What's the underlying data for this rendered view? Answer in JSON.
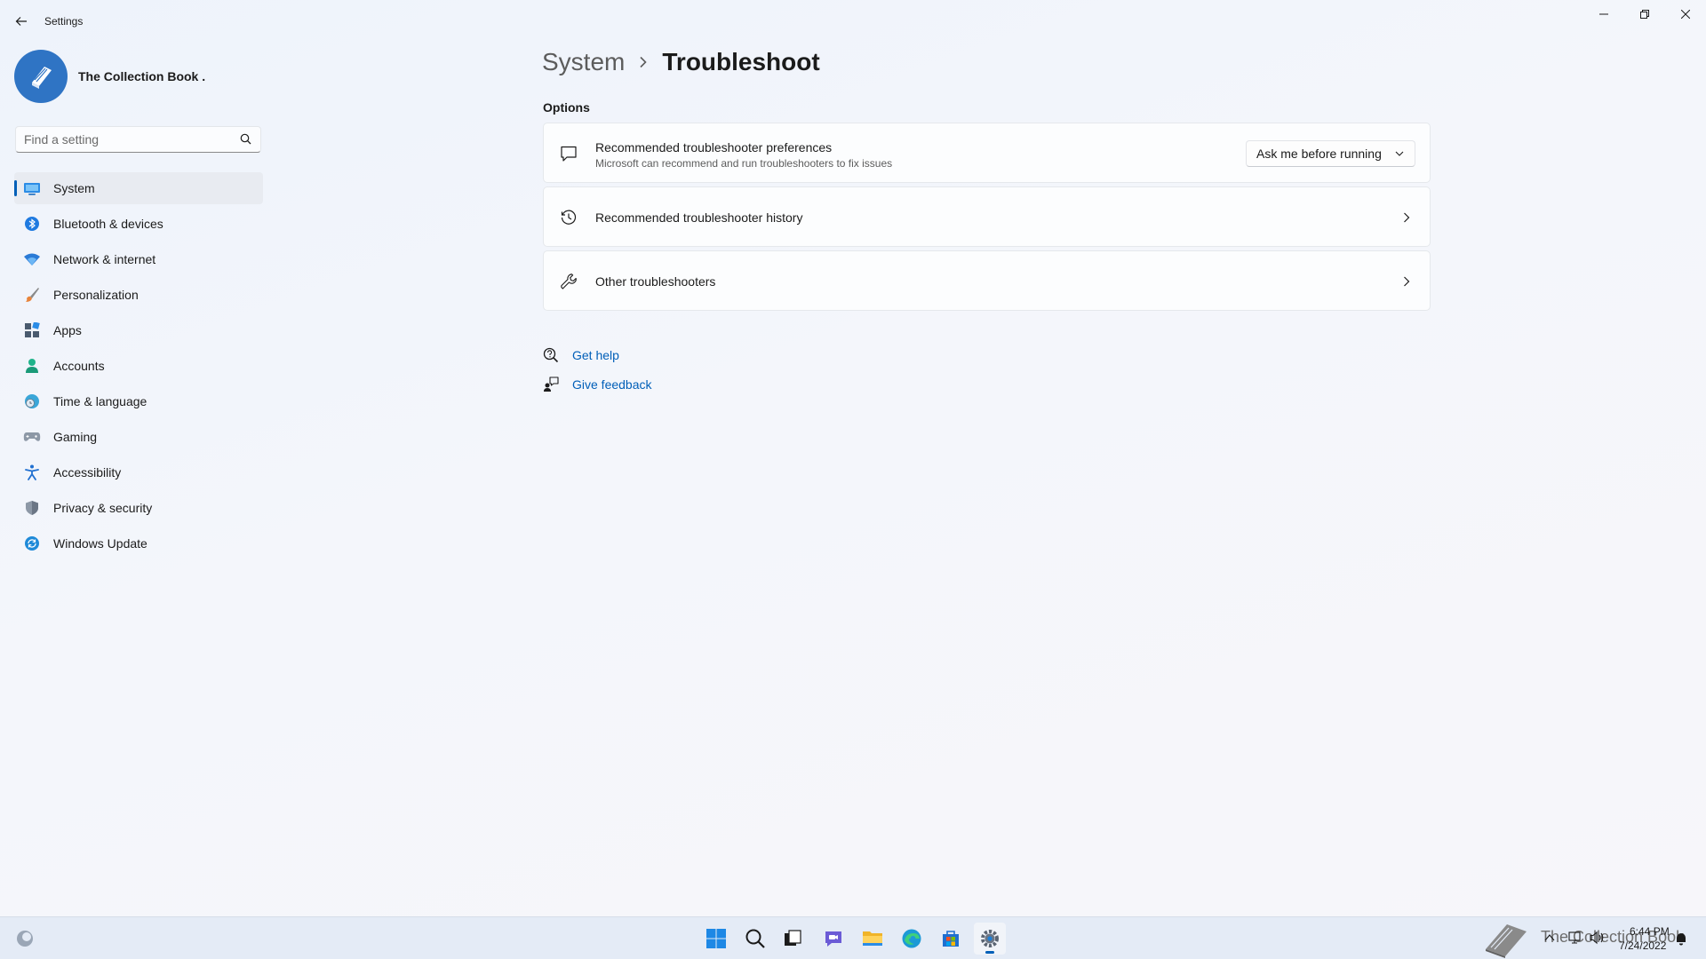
{
  "window": {
    "title": "Settings",
    "controls": {
      "minimize": "minimize-icon",
      "maximize": "restore-icon",
      "close": "close-icon"
    }
  },
  "profile": {
    "name": "The Collection Book ."
  },
  "search": {
    "placeholder": "Find a setting"
  },
  "sidebar": {
    "items": [
      {
        "label": "System",
        "icon": "monitor-icon",
        "active": true
      },
      {
        "label": "Bluetooth & devices",
        "icon": "bluetooth-icon"
      },
      {
        "label": "Network & internet",
        "icon": "wifi-icon"
      },
      {
        "label": "Personalization",
        "icon": "brush-icon"
      },
      {
        "label": "Apps",
        "icon": "apps-icon"
      },
      {
        "label": "Accounts",
        "icon": "account-icon"
      },
      {
        "label": "Time & language",
        "icon": "globe-clock-icon"
      },
      {
        "label": "Gaming",
        "icon": "gamepad-icon"
      },
      {
        "label": "Accessibility",
        "icon": "accessibility-icon"
      },
      {
        "label": "Privacy & security",
        "icon": "shield-icon"
      },
      {
        "label": "Windows Update",
        "icon": "update-icon"
      }
    ]
  },
  "breadcrumb": {
    "parent": "System",
    "current": "Troubleshoot"
  },
  "main": {
    "section_title": "Options",
    "cards": [
      {
        "title": "Recommended troubleshooter preferences",
        "description": "Microsoft can recommend and run troubleshooters to fix issues",
        "icon": "chat-bubble-icon",
        "dropdown_value": "Ask me before running"
      },
      {
        "title": "Recommended troubleshooter history",
        "icon": "history-icon"
      },
      {
        "title": "Other troubleshooters",
        "icon": "wrench-icon"
      }
    ],
    "links": [
      {
        "label": "Get help",
        "icon": "help-icon"
      },
      {
        "label": "Give feedback",
        "icon": "feedback-icon"
      }
    ]
  },
  "taskbar": {
    "apps": [
      "start-icon",
      "search-icon",
      "task-view-icon",
      "chat-icon",
      "file-explorer-icon",
      "edge-icon",
      "store-icon",
      "settings-icon"
    ],
    "active_app": "settings-icon",
    "watermark": "The Collection Book",
    "time": "6:44 PM",
    "date": "7/24/2022"
  },
  "colors": {
    "accent": "#005fb8",
    "avatar": "#2f74c4",
    "background": "#f2f5fb"
  }
}
